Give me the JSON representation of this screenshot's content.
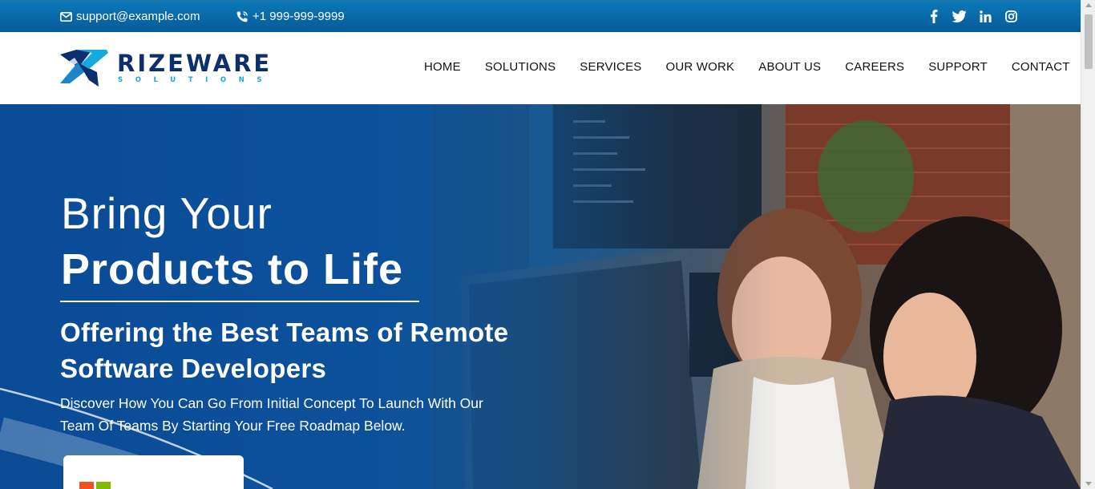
{
  "topbar": {
    "email": "support@example.com",
    "phone": "+1 999-999-9999",
    "social_icons": [
      "facebook-icon",
      "twitter-icon",
      "linkedin-icon",
      "instagram-icon"
    ]
  },
  "header": {
    "logo": {
      "brand": "RIZEWARE",
      "tagline": "SOLUTIONS"
    },
    "nav": [
      {
        "label": "HOME"
      },
      {
        "label": "SOLUTIONS"
      },
      {
        "label": "SERVICES"
      },
      {
        "label": "OUR WORK"
      },
      {
        "label": "ABOUT US"
      },
      {
        "label": "CAREERS"
      },
      {
        "label": "SUPPORT"
      },
      {
        "label": "CONTACT"
      }
    ]
  },
  "hero": {
    "title_line1": "Bring Your",
    "title_line2": "Products to Life",
    "subtitle": "Offering the Best Teams of Remote Software Developers",
    "description": "Discover How You Can Go From Initial Concept To Launch With Our Team Of Teams By Starting Your Free Roadmap Below."
  },
  "colors": {
    "topbar": "#0b79b8",
    "brand_navy": "#0d2f6e",
    "brand_cyan": "#15a9e0",
    "hero_blue": "#0d4c8f"
  }
}
